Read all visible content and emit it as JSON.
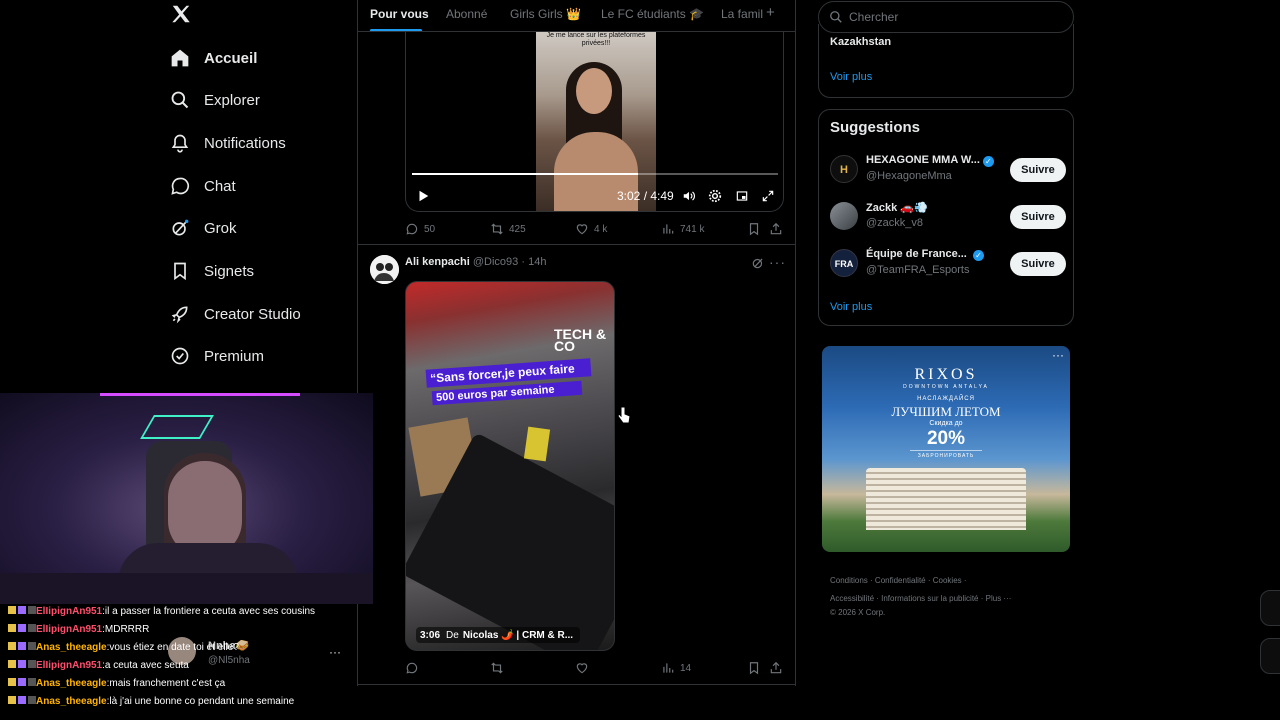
{
  "nav": {
    "items": [
      {
        "label": "Accueil",
        "icon": "home-icon"
      },
      {
        "label": "Explorer",
        "icon": "search-icon"
      },
      {
        "label": "Notifications",
        "icon": "bell-icon"
      },
      {
        "label": "Chat",
        "icon": "chat-icon"
      },
      {
        "label": "Grok",
        "icon": "grok-icon"
      },
      {
        "label": "Signets",
        "icon": "bookmark-icon"
      },
      {
        "label": "Creator Studio",
        "icon": "rocket-icon"
      },
      {
        "label": "Premium",
        "icon": "verified-icon"
      }
    ]
  },
  "tabs": [
    {
      "label": "Pour vous",
      "active": true
    },
    {
      "label": "Abonné",
      "active": false
    },
    {
      "label": "Girls Girls 👑",
      "active": false
    },
    {
      "label": "Le FC étudiants 🎓",
      "active": false
    },
    {
      "label": "La famil",
      "active": false
    }
  ],
  "tabs_plus": "+",
  "video": {
    "thumb_text": "Je me lance sur les plateformes privées!!!",
    "time": "3:02 / 4:49",
    "progress_fraction": 0.617
  },
  "post1_stats": {
    "replies": "50",
    "reposts": "425",
    "likes": "4 k",
    "views": "741 k"
  },
  "post2": {
    "author": "Ali kenpachi",
    "handle": "@Dico93",
    "time": "14h",
    "more": "···",
    "media_brand": "TECH & CO",
    "media_caption": "“Sans forcer,je peux faire",
    "media_caption2": "500 euros par semaine",
    "media_duration": "3:06",
    "media_by": "De",
    "media_source": "Nicolas 🌶️ | CRM & R...",
    "stats": {
      "replies": "",
      "reposts": "",
      "likes": "",
      "views": "14"
    }
  },
  "search": {
    "placeholder": "Chercher"
  },
  "trends": {
    "last_item": "Kazakhstan",
    "voir_plus": "Voir plus"
  },
  "suggestions": {
    "title": "Suggestions",
    "items": [
      {
        "name": "HEXAGONE MMA W...",
        "handle": "@HexagoneMma",
        "button": "Suivre",
        "verified": true
      },
      {
        "name": "Zackk 🚗💨",
        "handle": "@zackk_v8",
        "button": "Suivre",
        "verified": false
      },
      {
        "name": "Équipe de France... ",
        "handle": "@TeamFRA_Esports",
        "button": "Suivre",
        "verified": true
      }
    ],
    "voir_plus": "Voir plus",
    "fra_logo": "FRA"
  },
  "ad": {
    "brand": "RIXOS",
    "sub": "DOWNTOWN ANTALYA",
    "line1": "НАСЛАЖДАЙСЯ",
    "line2": "ЛУЧШИМ ЛЕТОМ",
    "line3": "Скидка до",
    "line4": "20%",
    "cta": "ЗАБРОНИРОВАТЬ",
    "more": "···"
  },
  "footer": {
    "line1": [
      "Conditions",
      "Confidentialité",
      "Cookies"
    ],
    "line2": [
      "Accessibilité",
      "Informations sur la publicité",
      "Plus ···"
    ],
    "copyright": "© 2026 X Corp."
  },
  "chat": {
    "messages": [
      {
        "user": "ElIipignAn951",
        "text": "il a passer la frontiere a ceuta avec ses cousins",
        "color": "#ff4f6d"
      },
      {
        "user": "ElIipignAn951",
        "text": "MDRRRR",
        "color": "#ff4f6d"
      },
      {
        "user": "Anas_theeagle",
        "text": "vous étiez en date toi et elle?",
        "color": "#ffb400"
      },
      {
        "user": "ElIipignAn951",
        "text": "a ceuta avec seuta",
        "color": "#ff4f6d"
      },
      {
        "user": "Anas_theeagle",
        "text": "mais franchement c'est ça",
        "color": "#ffb400"
      },
      {
        "user": "Anas_theeagle",
        "text": "là j'ai une bonne co pendant une semaine",
        "color": "#ffb400"
      }
    ],
    "ghost_name": "Nnha🥪",
    "ghost_handle": "@Nl5nha",
    "ghost_more": "···"
  },
  "colors": {
    "accent": "#1d9bf0",
    "background": "#000000",
    "border": "#2f3336",
    "muted": "#71767b"
  }
}
